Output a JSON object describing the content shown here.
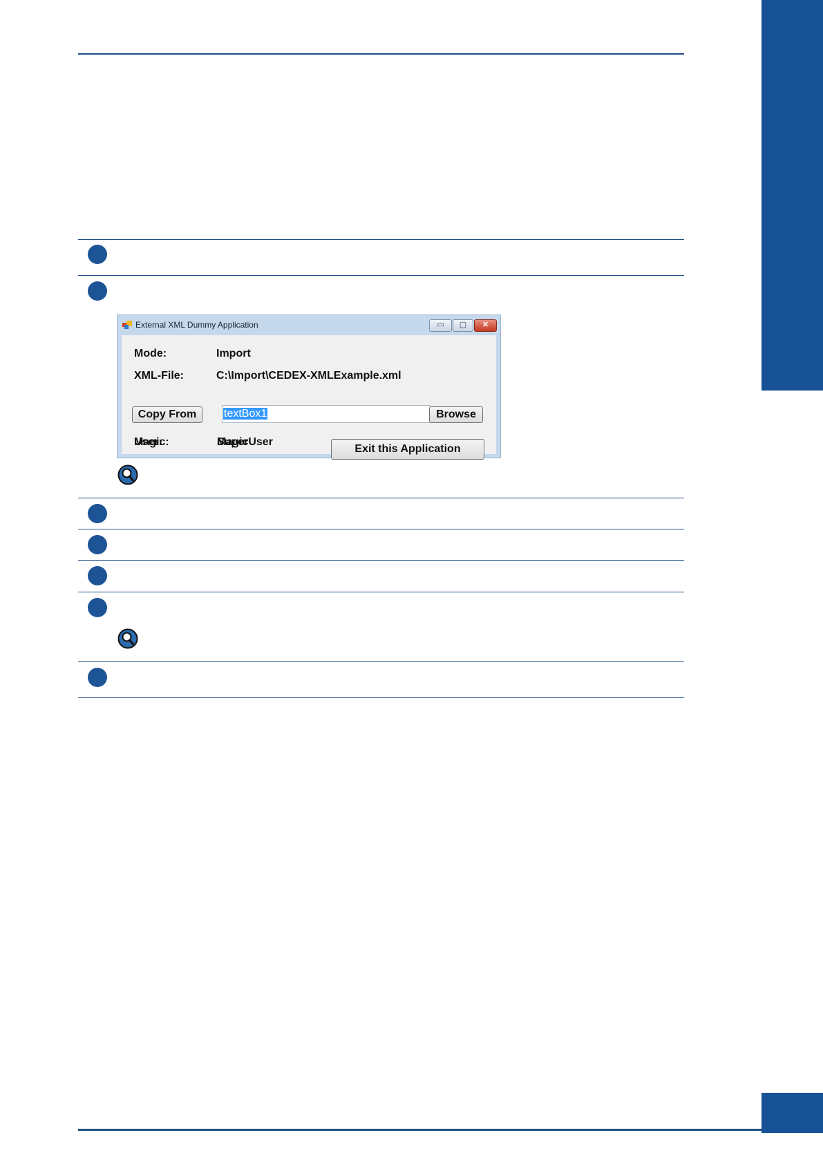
{
  "colors": {
    "accent": "#175196",
    "step": "#1d5496",
    "rule": "#1f4f86"
  },
  "steps": [
    {
      "icon": "step-bullet"
    },
    {
      "icon": "step-bullet"
    },
    {
      "icon": "step-bullet"
    },
    {
      "icon": "step-bullet"
    },
    {
      "icon": "step-bullet"
    },
    {
      "icon": "step-bullet"
    },
    {
      "icon": "step-bullet"
    }
  ],
  "notes": [
    {
      "icon": "magnifier-icon"
    },
    {
      "icon": "magnifier-icon"
    }
  ],
  "window": {
    "title": "External XML Dummy Application",
    "controls": {
      "minimize": "▭",
      "maximize": "▢",
      "close": "✕"
    },
    "mode_label": "Mode:",
    "mode_value": "Import",
    "xml_label": "XML-File:",
    "xml_value": "C:\\Import\\CEDEX-XMLExample.xml",
    "copy_from_button": "Copy From",
    "textbox_value": "textBox1",
    "browse_button": "Browse",
    "user_label": "User:",
    "user_value": "SuperUser",
    "magic_label": "Magic:",
    "magic_value": "Magic",
    "exit_button": "Exit this Application"
  }
}
